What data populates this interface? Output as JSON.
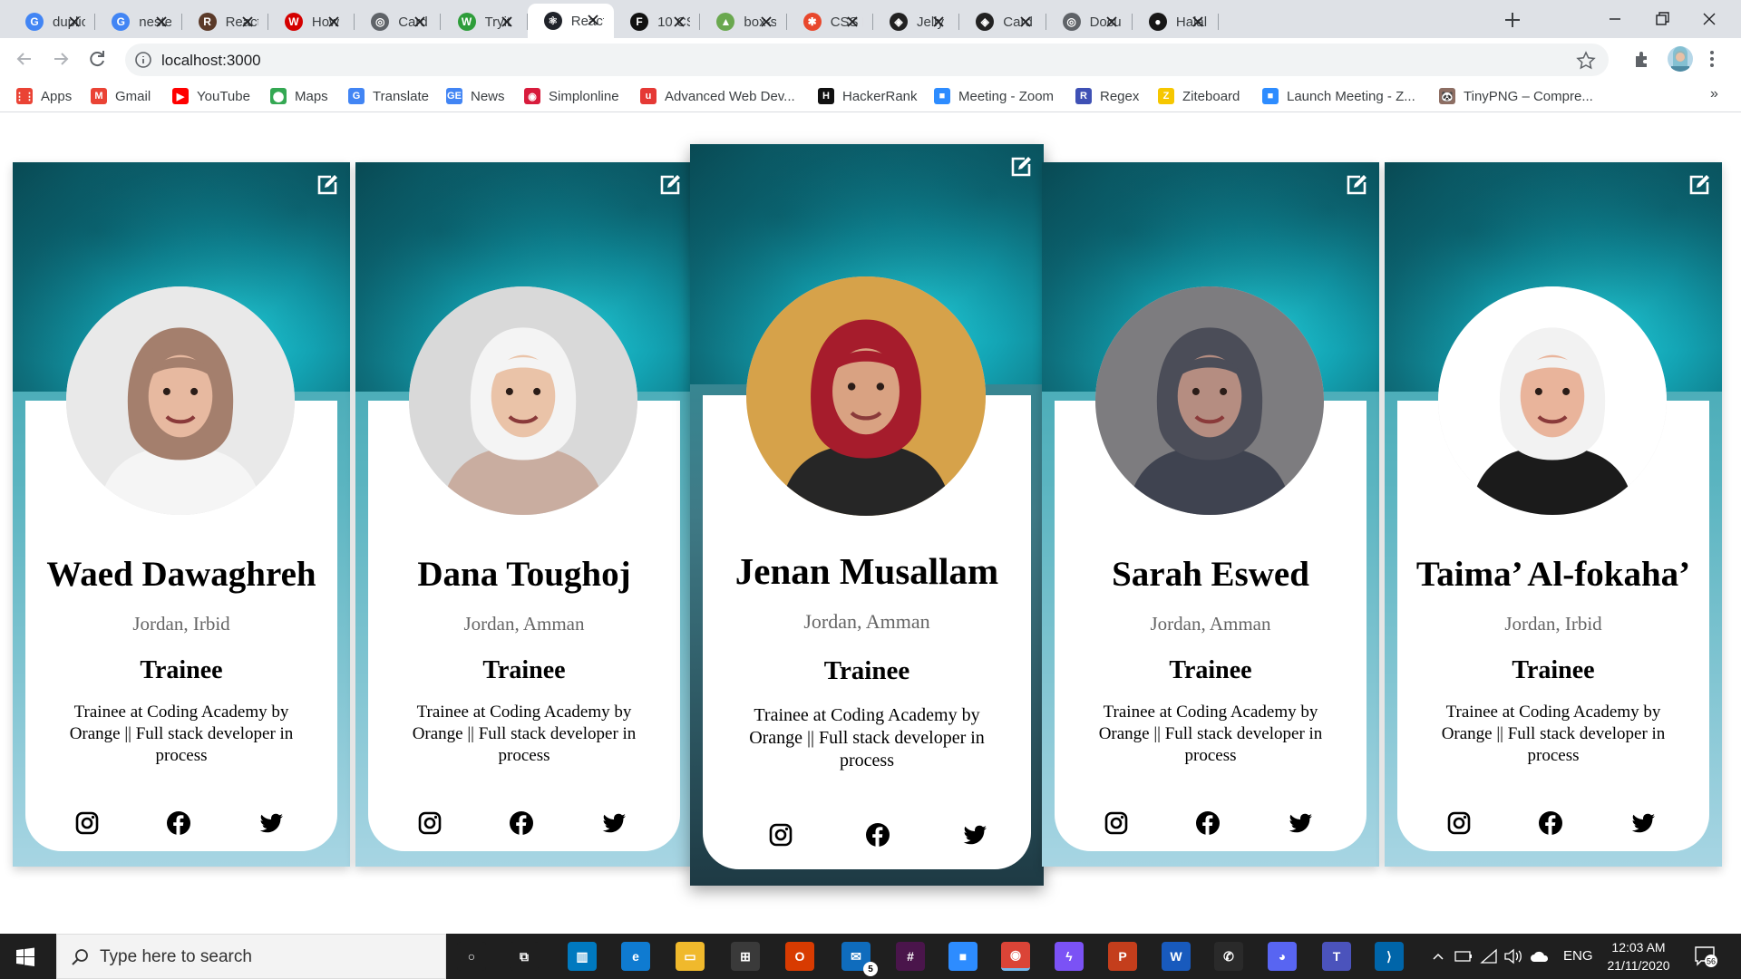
{
  "browser": {
    "tabs": [
      {
        "title": "duplic",
        "fav_color": "#4285f4",
        "fav_letter": "G"
      },
      {
        "title": "neste",
        "fav_color": "#4285f4",
        "fav_letter": "G"
      },
      {
        "title": "React",
        "fav_color": "#5b3a29",
        "fav_letter": "R"
      },
      {
        "title": "How",
        "fav_color": "#d40000",
        "fav_letter": "W"
      },
      {
        "title": "Card",
        "fav_color": "#5f6368",
        "fav_letter": "◎"
      },
      {
        "title": "Tryit",
        "fav_color": "#2e9d3a",
        "fav_letter": "W"
      },
      {
        "title": "React",
        "fav_color": "#20232a",
        "fav_letter": "⚛"
      },
      {
        "title": "10 CS",
        "fav_color": "#111111",
        "fav_letter": "F"
      },
      {
        "title": "box-s",
        "fav_color": "#6aa84f",
        "fav_letter": "▲"
      },
      {
        "title": "CSS E",
        "fav_color": "#e8472c",
        "fav_letter": "✱"
      },
      {
        "title": "Jelly",
        "fav_color": "#222222",
        "fav_letter": "◈"
      },
      {
        "title": "Card",
        "fav_color": "#222222",
        "fav_letter": "◈"
      },
      {
        "title": "Docu",
        "fav_color": "#5f6368",
        "fav_letter": "◎"
      },
      {
        "title": "Halal",
        "fav_color": "#181717",
        "fav_letter": "●"
      }
    ],
    "active_tab_index": 6,
    "url": "localhost:3000",
    "bookmarks": [
      {
        "label": "Apps",
        "icon_color": "#ea4335",
        "icon": "⋮⋮"
      },
      {
        "label": "Gmail",
        "icon_color": "#ea4335",
        "icon": "M"
      },
      {
        "label": "YouTube",
        "icon_color": "#ff0000",
        "icon": "▶"
      },
      {
        "label": "Maps",
        "icon_color": "#34a853",
        "icon": "⬤"
      },
      {
        "label": "Translate",
        "icon_color": "#4285f4",
        "icon": "G"
      },
      {
        "label": "News",
        "icon_color": "#4285f4",
        "icon": "GE"
      },
      {
        "label": "Simplonline",
        "icon_color": "#d81b3c",
        "icon": "◉"
      },
      {
        "label": "Advanced Web Dev...",
        "icon_color": "#e53935",
        "icon": "u"
      },
      {
        "label": "HackerRank",
        "icon_color": "#111111",
        "icon": "H"
      },
      {
        "label": "Meeting - Zoom",
        "icon_color": "#2d8cff",
        "icon": "■"
      },
      {
        "label": "Regex",
        "icon_color": "#3f51b5",
        "icon": "R"
      },
      {
        "label": "Ziteboard",
        "icon_color": "#f6c700",
        "icon": "Z"
      },
      {
        "label": "Launch Meeting - Z...",
        "icon_color": "#2d8cff",
        "icon": "■"
      },
      {
        "label": "TinyPNG – Compre...",
        "icon_color": "#8d6e63",
        "icon": "🐼"
      }
    ],
    "bookmarks_more": "»"
  },
  "cards": [
    {
      "name": "Waed Dawaghreh",
      "location": "Jordan, Irbid",
      "role": "Trainee",
      "bio": "Trainee at Coding Academy by Orange || Full stack developer in process",
      "photo_bg": "#e9e9e9",
      "scarf": "#a47f6d",
      "skin": "#e7b9a0",
      "cloth": "#f5f5f5"
    },
    {
      "name": "Dana Toughoj",
      "location": "Jordan, Amman",
      "role": "Trainee",
      "bio": "Trainee at Coding Academy by Orange || Full stack developer in process",
      "photo_bg": "#d9d9d9",
      "scarf": "#f4f4f4",
      "skin": "#eac3a8",
      "cloth": "#c9ada0"
    },
    {
      "name": "Jenan Musallam",
      "location": "Jordan, Amman",
      "role": "Trainee",
      "bio": "Trainee at Coding Academy by Orange || Full stack developer in process",
      "photo_bg": "#d6a24a",
      "scarf": "#a61c2c",
      "skin": "#d9a282",
      "cloth": "#262626"
    },
    {
      "name": "Sarah Eswed",
      "location": "Jordan, Amman",
      "role": "Trainee",
      "bio": "Trainee at Coding Academy by Orange || Full stack developer in process",
      "photo_bg": "#7d7c7f",
      "scarf": "#4b4d58",
      "skin": "#b58d81",
      "cloth": "#3f4350"
    },
    {
      "name": "Taima’ Al-fokaha’",
      "location": "Jordan, Irbid",
      "role": "Trainee",
      "bio": "Trainee at Coding Academy by Orange || Full stack developer in process",
      "photo_bg": "#ffffff",
      "scarf": "#f2f2f2",
      "skin": "#e9b49b",
      "cloth": "#1b1b1b"
    }
  ],
  "taskbar": {
    "search_placeholder": "Type here to search",
    "apps": [
      {
        "name": "cortana",
        "color": "#1f1f1f",
        "glyph": "○"
      },
      {
        "name": "task-view",
        "color": "#1f1f1f",
        "glyph": "⧉"
      },
      {
        "name": "trello",
        "color": "#0079bf",
        "glyph": "▥"
      },
      {
        "name": "edge",
        "color": "#0f7bd1",
        "glyph": "e"
      },
      {
        "name": "file-explorer",
        "color": "#f0b92c",
        "glyph": "▭"
      },
      {
        "name": "store",
        "color": "#3a3a3a",
        "glyph": "⊞"
      },
      {
        "name": "office",
        "color": "#d83b01",
        "glyph": "O"
      },
      {
        "name": "mail",
        "color": "#0f6cbd",
        "glyph": "✉"
      },
      {
        "name": "slack",
        "color": "#4a154b",
        "glyph": "#"
      },
      {
        "name": "zoom",
        "color": "#2d8cff",
        "glyph": "■"
      },
      {
        "name": "chrome",
        "color": "#db4437",
        "glyph": "◉"
      },
      {
        "name": "messenger",
        "color": "#7b52f5",
        "glyph": "ϟ"
      },
      {
        "name": "powerpoint",
        "color": "#c43e1c",
        "glyph": "P"
      },
      {
        "name": "word",
        "color": "#185abd",
        "glyph": "W"
      },
      {
        "name": "whatsapp",
        "color": "#2a2a2a",
        "glyph": "✆"
      },
      {
        "name": "discord",
        "color": "#5865f2",
        "glyph": "◕"
      },
      {
        "name": "teams",
        "color": "#4b53bc",
        "glyph": "T"
      },
      {
        "name": "vscode",
        "color": "#0065a9",
        "glyph": "⟩"
      }
    ],
    "mail_badge": "5",
    "language": "ENG",
    "time": "12:03 AM",
    "date": "21/11/2020",
    "notifications": "56"
  }
}
